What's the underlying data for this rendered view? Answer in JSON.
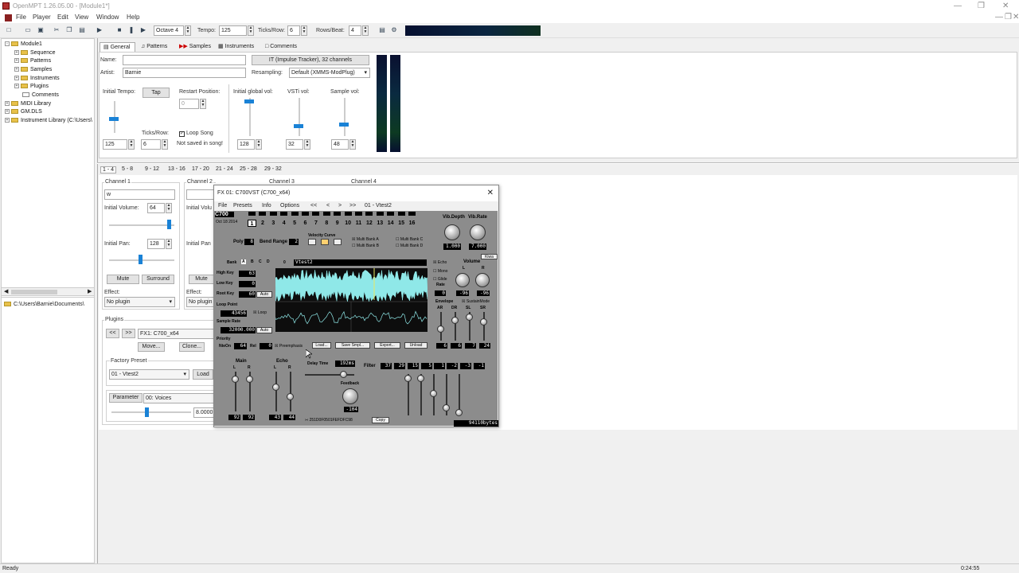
{
  "window": {
    "title": "OpenMPT 1.26.05.00 - [Module1*]"
  },
  "menu": [
    "File",
    "Player",
    "Edit",
    "View",
    "Window",
    "Help"
  ],
  "toolbar": {
    "octave": "Octave 4",
    "tempo_label": "Tempo:",
    "tempo_value": "125",
    "ticks_label": "Ticks/Row:",
    "ticks_value": "6",
    "rows_label": "Rows/Beat:",
    "rows_value": "4"
  },
  "tree": {
    "items": [
      {
        "label": "Module1",
        "depth": 0
      },
      {
        "label": "Sequence",
        "depth": 1
      },
      {
        "label": "Patterns",
        "depth": 1
      },
      {
        "label": "Samples",
        "depth": 1
      },
      {
        "label": "Instruments",
        "depth": 1
      },
      {
        "label": "Plugins",
        "depth": 1
      },
      {
        "label": "Comments",
        "depth": 1
      },
      {
        "label": "MIDI Library",
        "depth": 0
      },
      {
        "label": "GM.DLS",
        "depth": 0
      },
      {
        "label": "Instrument Library (C:\\Users\\",
        "depth": 0
      }
    ],
    "path": "C:\\Users\\Barnie\\Documents\\"
  },
  "tabs": [
    "General",
    "Patterns",
    "Samples",
    "Instruments",
    "Comments"
  ],
  "general": {
    "name_label": "Name:",
    "artist_label": "Artist:",
    "artist_value": "Barnie",
    "format": "IT (Impulse Tracker), 32 channels",
    "resampling_label": "Resampling:",
    "resampling_value": "Default (XMMS-ModPlug)",
    "initial_tempo_label": "Initial Tempo:",
    "tap_label": "Tap",
    "tempo_value": "125",
    "ticks_label": "Ticks/Row:",
    "ticks_value": "6",
    "restart_label": "Restart Position:",
    "restart_value": "0",
    "loop_song_label": "Loop Song",
    "not_saved_label": "Not saved in song!",
    "global_vol_label": "Initial global vol:",
    "global_vol_value": "128",
    "vsti_vol_label": "VSTi vol:",
    "vsti_vol_value": "32",
    "sample_vol_label": "Sample vol:",
    "sample_vol_value": "48"
  },
  "pattern_tabs": [
    "1 - 4",
    "5 - 8",
    "9 - 12",
    "13 - 16",
    "17 - 20",
    "21 - 24",
    "25 - 28",
    "29 - 32"
  ],
  "channels": {
    "ch1": {
      "title": "Channel 1",
      "name": "w",
      "init_vol_label": "Initial Volume:",
      "init_vol_value": "64",
      "init_pan_label": "Initial Pan:",
      "init_pan_value": "128",
      "mute": "Mute",
      "surround": "Surround",
      "effect_label": "Effect:",
      "effect_value": "No plugin"
    },
    "ch2": {
      "title": "Channel 2",
      "init_vol_label": "Initial Volu",
      "init_pan_label": "Initial Pan",
      "mute": "Mute",
      "effect_label": "Effect:",
      "effect_value": "No plugin"
    },
    "ch3_title": "Channel 3",
    "ch4_title": "Channel 4"
  },
  "plugins": {
    "title": "Plugins",
    "prev": "<<",
    "next": ">>",
    "selected": "FX1: C700_x64",
    "move": "Move...",
    "clone": "Clone...",
    "factory_label": "Factory Preset",
    "factory_value": "01 - Vtest2",
    "load": "Load",
    "param_label": "Parameter",
    "param_value": "00: Voices",
    "param_number": "8.0000"
  },
  "vst": {
    "title": "FX 01: C700VST (C700_x64)",
    "menu": [
      "File",
      "Presets",
      "Info",
      "Options",
      "<<",
      "<",
      ">",
      ">>",
      "01 - Vtest2"
    ],
    "logo": "C700",
    "date": "Oct 18 2014",
    "channels": [
      "1",
      "2",
      "3",
      "4",
      "5",
      "6",
      "7",
      "8",
      "9",
      "10",
      "11",
      "12",
      "13",
      "14",
      "15",
      "16"
    ],
    "poly_label": "Poly",
    "poly_value": "8",
    "bend_label": "Bend Range",
    "bend_value": "2",
    "velocity_label": "Velocity Curve",
    "multibank": [
      "Multi Bank A",
      "Multi Bank B",
      "Multi Bank C",
      "Multi Bank D"
    ],
    "vib_depth_label": "Vib.Depth",
    "vib_rate_label": "Vib.Rate",
    "vib_depth_value": "1.000",
    "vib_rate_value": "7.000",
    "kiwa": "Kiwa",
    "bank_label": "Bank",
    "bank_letters": [
      "A",
      "B",
      "C",
      "D"
    ],
    "program_number": "0",
    "program_name": "Vtest2",
    "high_key_label": "High Key",
    "high_key_value": "63",
    "low_key_label": "Low Key",
    "low_key_value": "0",
    "root_key_label": "Root Key",
    "root_key_value": "60",
    "auto_label": "Auto",
    "loop_point_label": "Loop Point",
    "loop_point_value": "43456",
    "loop_label": "Loop",
    "sample_rate_label": "Sample Rate",
    "sample_rate_value": "32000.000",
    "priority_label": "Priority",
    "noteon_label": "NteOn",
    "noteon_value": "64",
    "rel_label": "Rel",
    "rel_value": "0",
    "preemphasis_label": "Preemphasis",
    "load_btn": "Load...",
    "save_btn": "Save Smpl...",
    "export_btn": "Export...",
    "unload_btn": "Unload",
    "echo_label": "Echo",
    "mono_label": "Mono",
    "glide_label": "Glide",
    "rate_label": "Rate",
    "rate_value": "0",
    "volume_label": "Volume",
    "vol_l_value": "-96",
    "vol_r_value": "-96",
    "envelope_label": "Envelope",
    "sustain_label": "SustainMode",
    "env_labels": [
      "AR",
      "DR",
      "SL",
      "SR"
    ],
    "env_values": [
      "6",
      "6",
      "7",
      "24"
    ],
    "main_label": "Main",
    "echo_sec_label": "Echo",
    "main_values": [
      "92",
      "92"
    ],
    "echo_values": [
      "43",
      "44"
    ],
    "delay_label": "Delay Time",
    "delay_value": "192ms",
    "feedback_label": "Feedback",
    "feedback_value": "-104",
    "filter_label": "Filter",
    "filter_values": [
      "37",
      "29",
      "15",
      "5",
      "1",
      "-2",
      "-3",
      "-1"
    ],
    "hex": "251D0F0501FEFDFC98",
    "copy_btn": "Copy",
    "bytes": "94110bytes"
  },
  "status": {
    "left": "Ready",
    "right": "0:24:55"
  }
}
